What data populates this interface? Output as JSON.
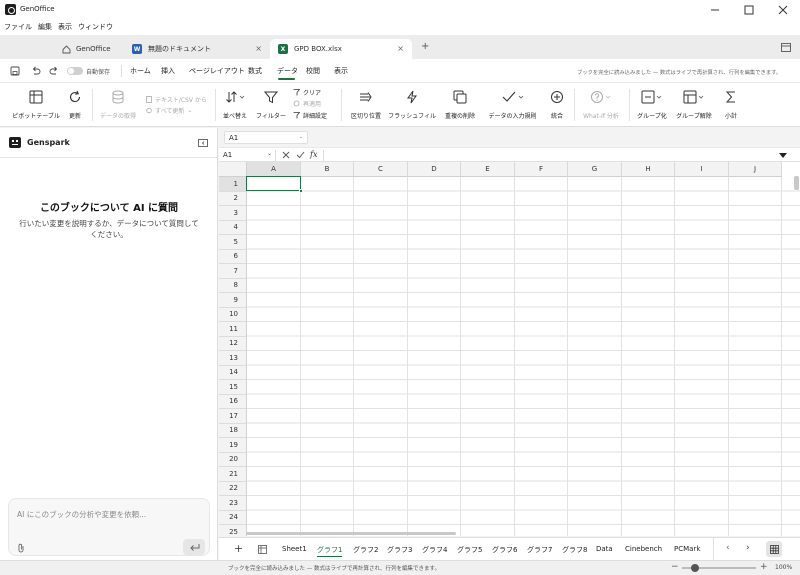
{
  "window": {
    "title": "GenOffice"
  },
  "menu": [
    "ファイル",
    "編集",
    "表示",
    "ウィンドウ"
  ],
  "tabs": [
    {
      "label": "GenOffice",
      "icon": "home-icon"
    },
    {
      "label": "無題のドキュメント",
      "icon": "word-doc-icon",
      "close": "×"
    },
    {
      "label": "GPD BOX.xlsx",
      "icon": "excel-icon",
      "close": "×",
      "active": true
    }
  ],
  "new_tab": "+",
  "autosave_label": "自動保存",
  "ribbon_tabs": [
    "ホーム",
    "挿入",
    "ページレイアウト",
    "数式",
    "データ",
    "校閲",
    "表示"
  ],
  "active_ribbon_tab": "データ",
  "ribbon_status": "ブックを完全に読み込みました — 数式はライブで再計算され、行列を編集できます。",
  "ribbon": {
    "pivot": "ピボットテーブル",
    "refresh": "更新",
    "get_data": "データの取得",
    "text_csv": "テキスト/CSV から",
    "refresh_all": "すべて更新",
    "sort": "並べ替え",
    "filter": "フィルター",
    "clear": "クリア",
    "reapply": "再適用",
    "advanced": "詳細設定",
    "text_to_columns": "区切り位置",
    "flash_fill": "フラッシュフィル",
    "remove_duplicates": "重複の削除",
    "data_validation": "データの入力規則",
    "consolidate": "統合",
    "what_if": "What-If 分析",
    "group": "グループ化",
    "ungroup": "グループ解除",
    "subtotal": "小計"
  },
  "assistant": {
    "name": "Genspark",
    "heading": "このブックについて AI に質問",
    "description": "行いたい変更を説明するか、データについて質問してください。",
    "input_placeholder": "AI にこのブックの分析や変更を依頼..."
  },
  "name_box_top": "A1",
  "formula_bar": {
    "name_box": "A1",
    "fx": "fx",
    "value": ""
  },
  "columns": [
    "A",
    "B",
    "C",
    "D",
    "E",
    "F",
    "G",
    "H",
    "I",
    "J"
  ],
  "rows": [
    "1",
    "2",
    "3",
    "4",
    "5",
    "6",
    "7",
    "8",
    "9",
    "10",
    "11",
    "12",
    "13",
    "14",
    "15",
    "16",
    "17",
    "18",
    "19",
    "20",
    "21",
    "22",
    "23",
    "24",
    "25"
  ],
  "selected_cell": "A1",
  "sheets": [
    "Sheet1",
    "グラフ1",
    "グラフ2",
    "グラフ3",
    "グラフ4",
    "グラフ5",
    "グラフ6",
    "グラフ7",
    "グラフ8",
    "Data",
    "Cinebench",
    "PCMark"
  ],
  "active_sheet": "グラフ1",
  "status": {
    "message": "ブックを完全に読み込みました — 数式はライブで再計算され、行列を編集できます。",
    "zoom": "100%"
  },
  "colors": {
    "accent_green": "#1e7145",
    "selection": "#217346",
    "excel_icon": "#1d7044",
    "word_icon": "#2b5fb4"
  }
}
